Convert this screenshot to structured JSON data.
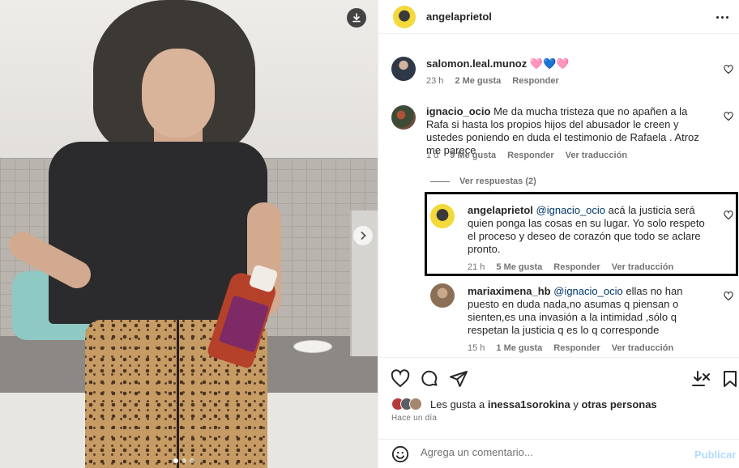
{
  "post": {
    "username": "angelaprietol",
    "carousel": {
      "total": 3,
      "active": 0
    }
  },
  "comments": [
    {
      "username": "salomon.leal.munoz",
      "text": "🩷💙🩷",
      "time": "23 h",
      "likes": "2 Me gusta",
      "reply": "Responder",
      "translate": ""
    },
    {
      "username": "ignacio_ocio",
      "text": "Me da mucha tristeza que no apañen a la Rafa si hasta los propios hijos del abusador le creen y ustedes poniendo en duda el testimonio de Rafaela . Atroz me parece",
      "time": "1 d",
      "likes": "9 Me gusta",
      "reply": "Responder",
      "translate": "Ver traducción"
    }
  ],
  "view_replies": "Ver respuestas (2)",
  "replies": [
    {
      "username": "angelaprietol",
      "mention": "@ignacio_ocio",
      "text": "acá la justicia será quien ponga las cosas en su lugar. Yo solo respeto el proceso y deseo de corazón que todo se aclare pronto.",
      "time": "21 h",
      "likes": "5 Me gusta",
      "reply": "Responder",
      "translate": "Ver traducción"
    },
    {
      "username": "mariaximena_hb",
      "mention": "@ignacio_ocio",
      "text": "ellas no han puesto en duda nada,no asumas q piensan o sienten,es una invasión a la intimidad ,sólo q respetan la justicia q es lo q corresponde",
      "time": "15 h",
      "likes": "1 Me gusta",
      "reply": "Responder",
      "translate": "Ver traducción"
    }
  ],
  "likes_line": {
    "prefix": "Les gusta a ",
    "user": "inessa1sorokina",
    "middle": " y ",
    "others": "otras personas"
  },
  "time_ago": "Hace un día",
  "add_comment": {
    "placeholder": "Agrega un comentario...",
    "publish": "Publicar"
  },
  "colors": {
    "mention": "#00376b",
    "muted": "#737373",
    "publish_disabled": "#b3dbff",
    "highlight_border": "#000000"
  },
  "icons": [
    "download-icon",
    "chevron-right-icon",
    "more-icon",
    "heart-icon",
    "comment-icon",
    "share-icon",
    "save-icon",
    "emoji-icon"
  ]
}
